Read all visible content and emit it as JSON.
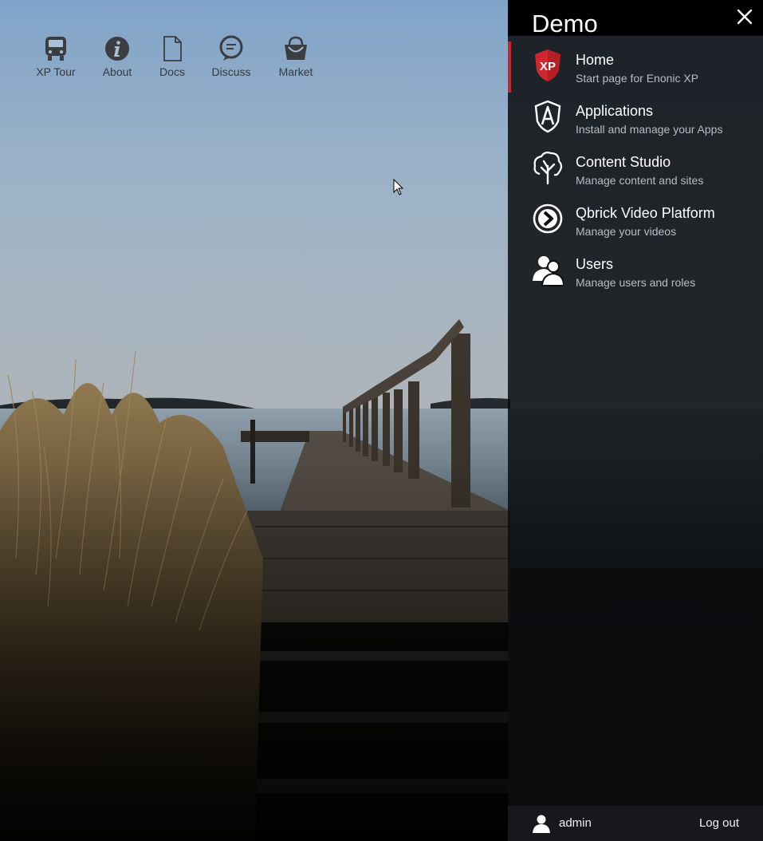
{
  "toolbar": {
    "items": [
      {
        "label": "XP Tour",
        "icon": "bus-icon"
      },
      {
        "label": "About",
        "icon": "info-icon"
      },
      {
        "label": "Docs",
        "icon": "document-icon"
      },
      {
        "label": "Discuss",
        "icon": "chat-bubble-icon"
      },
      {
        "label": "Market",
        "icon": "basket-icon"
      }
    ]
  },
  "launcher": {
    "title": "Demo",
    "close_icon": "close-icon",
    "apps": [
      {
        "name": "Home",
        "description": "Start page for Enonic XP",
        "icon": "xp-shield-icon",
        "active": true
      },
      {
        "name": "Applications",
        "description": "Install and manage your Apps",
        "icon": "applications-shield-icon",
        "active": false
      },
      {
        "name": "Content Studio",
        "description": "Manage content and sites",
        "icon": "tree-icon",
        "active": false
      },
      {
        "name": "Qbrick Video Platform",
        "description": "Manage your videos",
        "icon": "chevron-circle-icon",
        "active": false
      },
      {
        "name": "Users",
        "description": "Manage users and roles",
        "icon": "users-icon",
        "active": false
      }
    ],
    "footer": {
      "username": "admin",
      "logout_label": "Log out",
      "user_icon": "user-icon"
    }
  },
  "colors": {
    "accent": "#c8262e",
    "panel_bg": "#0c0d0f",
    "sky_top": "#7fa3c8",
    "sky_bottom": "#d8e4ee"
  }
}
